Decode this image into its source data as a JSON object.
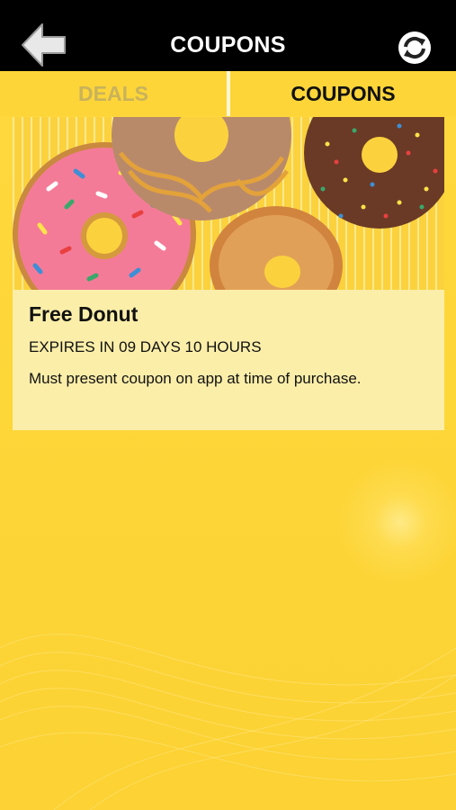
{
  "header": {
    "title": "COUPONS",
    "back_icon": "back-arrow-icon",
    "refresh_icon": "refresh-icon"
  },
  "tabs": [
    {
      "label": "DEALS",
      "active": false
    },
    {
      "label": "COUPONS",
      "active": true
    }
  ],
  "coupons": [
    {
      "title": "Free Donut",
      "expiry": "EXPIRES IN 09 DAYS 10 HOURS",
      "description": "Must present coupon on app at time of purchase.",
      "image": "donuts-image"
    }
  ],
  "colors": {
    "header_bg": "#000000",
    "background": "#fdd739",
    "card_bg": "#fbeea9",
    "inactive_tab_text": "#c9b25b"
  }
}
